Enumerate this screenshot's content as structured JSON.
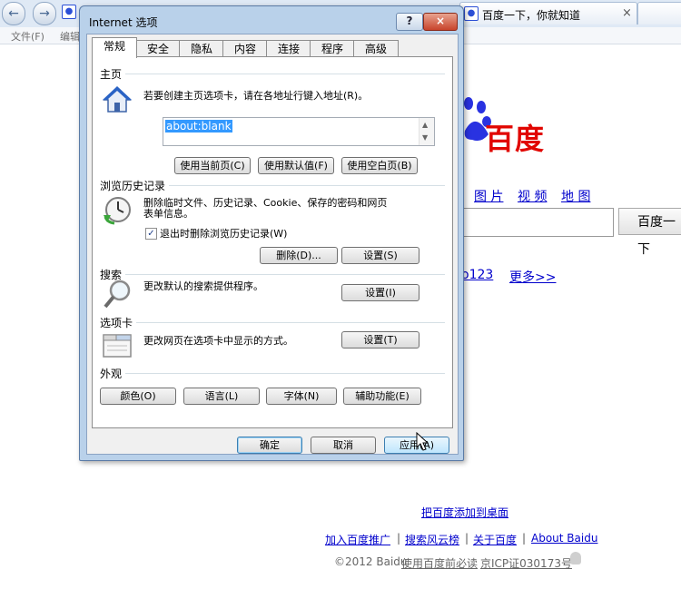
{
  "browser": {
    "menu": {
      "file": "文件(F)",
      "edit": "编辑"
    },
    "tab": {
      "title": "百度一下，你就知道",
      "close": "×"
    },
    "baidu": {
      "logo_text": "百度",
      "nav_links": {
        "images": "图 片",
        "video": "视 频",
        "map": "地 图"
      },
      "search_button": "百度一下",
      "link_hao123": "o123",
      "link_more": "更多>>",
      "add_desktop": "把百度添加到桌面",
      "footer_links": {
        "ads": "加入百度推广",
        "ranking": "搜索风云榜",
        "about": "关于百度",
        "about_en": "About Baidu"
      },
      "separator": "|",
      "copyright": "©2012 Baidu",
      "terms": "使用百度前必读",
      "icp": "京ICP证030173号"
    }
  },
  "dialog": {
    "title": "Internet 选项",
    "help": "?",
    "close": "×",
    "tabs": [
      "常规",
      "安全",
      "隐私",
      "内容",
      "连接",
      "程序",
      "高级"
    ],
    "active_tab": 0,
    "homepage": {
      "title": "主页",
      "desc": "若要创建主页选项卡，请在各地址行键入地址(R)。",
      "value": "about:blank",
      "buttons": {
        "current": "使用当前页(C)",
        "default": "使用默认值(F)",
        "blank": "使用空白页(B)"
      }
    },
    "history": {
      "title": "浏览历史记录",
      "desc_line1": "删除临时文件、历史记录、Cookie、保存的密码和网页",
      "desc_line2": "表单信息。",
      "checkbox_label": "退出时删除浏览历史记录(W)",
      "checkbox_checked": true,
      "check_mark": "✓",
      "delete_button": "删除(D)...",
      "settings_button": "设置(S)"
    },
    "search": {
      "title": "搜索",
      "desc": "更改默认的搜索提供程序。",
      "settings_button": "设置(I)"
    },
    "tabs_section": {
      "title": "选项卡",
      "desc": "更改网页在选项卡中显示的方式。",
      "settings_button": "设置(T)"
    },
    "appearance": {
      "title": "外观",
      "buttons": {
        "colors": "颜色(O)",
        "languages": "语言(L)",
        "fonts": "字体(N)",
        "accessibility": "辅助功能(E)"
      }
    },
    "footer": {
      "ok": "确定",
      "cancel": "取消",
      "apply": "应用(A)"
    }
  }
}
